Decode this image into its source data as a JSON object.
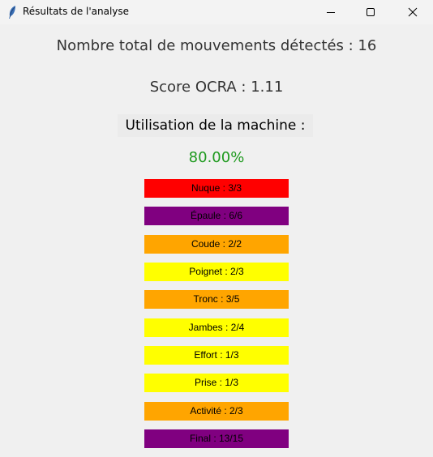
{
  "window": {
    "title": "Résultats de l'analyse",
    "icon": "feather-icon"
  },
  "results": {
    "total_movements": "Nombre total de mouvements détectés : 16",
    "ocra_score": "Score OCRA : 1.11",
    "machine_label": "Utilisation de la machine :",
    "machine_value": "80.00%",
    "machine_value_color": "#1f9a1f"
  },
  "colors": {
    "red": "#ff0000",
    "purple": "#800080",
    "orange": "#ffa500",
    "yellow": "#ffff00"
  },
  "scores": [
    {
      "label": "Nuque : 3/3",
      "color": "#ff0000"
    },
    {
      "label": "Épaule : 6/6",
      "color": "#800080"
    },
    {
      "label": "Coude : 2/2",
      "color": "#ffa500"
    },
    {
      "label": "Poignet : 2/3",
      "color": "#ffff00"
    },
    {
      "label": "Tronc : 3/5",
      "color": "#ffa500"
    },
    {
      "label": "Jambes : 2/4",
      "color": "#ffff00"
    },
    {
      "label": "Effort : 1/3",
      "color": "#ffff00"
    },
    {
      "label": "Prise : 1/3",
      "color": "#ffff00"
    },
    {
      "label": "Activité : 2/3",
      "color": "#ffa500"
    },
    {
      "label": "Final : 13/15",
      "color": "#800080"
    }
  ]
}
